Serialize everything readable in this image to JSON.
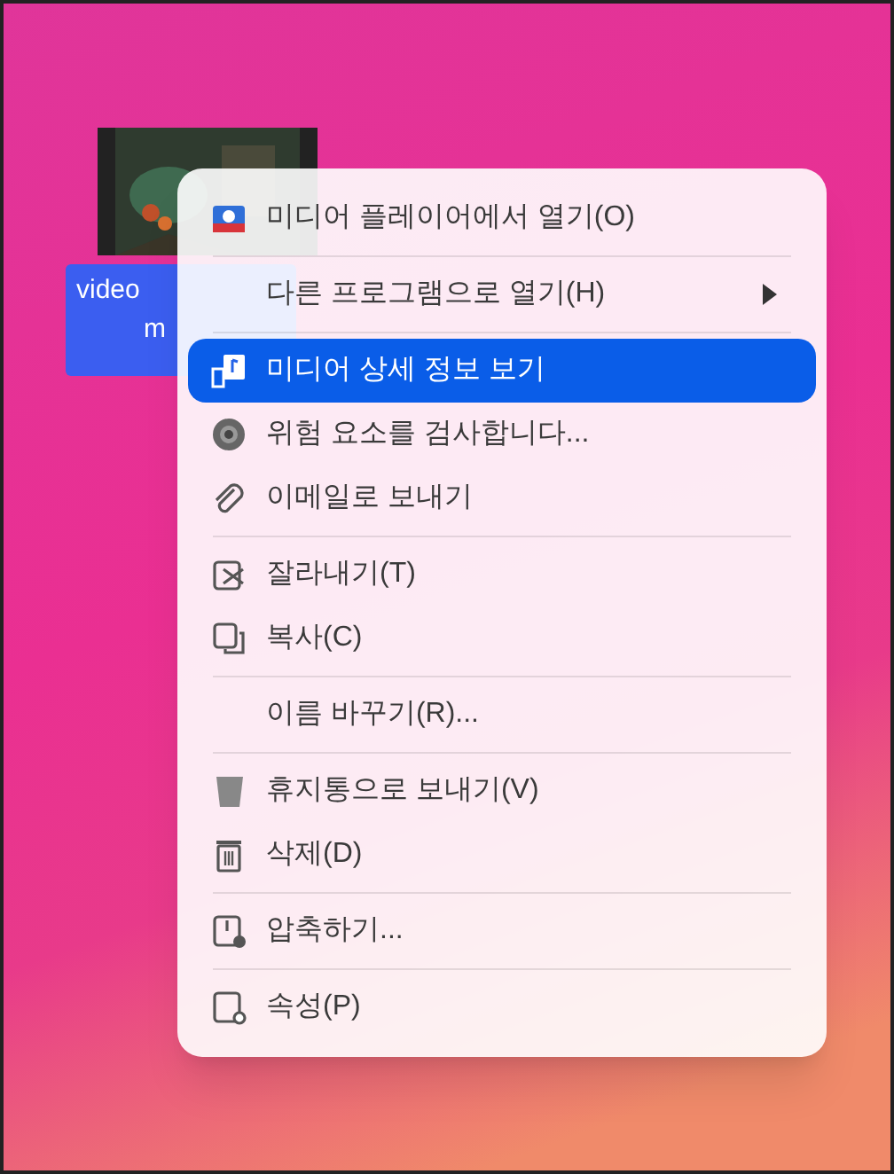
{
  "desktop_icon": {
    "label_lines": [
      "video",
      "m"
    ],
    "selected": true
  },
  "context_menu": {
    "items": [
      {
        "kind": "item",
        "label": "미디어 플레이어에서 열기(O)",
        "selected": false,
        "submenu": false
      },
      {
        "kind": "separator"
      },
      {
        "kind": "item",
        "label": "다른 프로그램으로 열기(H)",
        "selected": false,
        "submenu": true
      },
      {
        "kind": "separator"
      },
      {
        "kind": "item",
        "label": "미디어 상세 정보 보기",
        "selected": true,
        "submenu": false
      },
      {
        "kind": "item",
        "label": "위험 요소를 검사합니다...",
        "selected": false,
        "submenu": false
      },
      {
        "kind": "item",
        "label": "이메일로 보내기",
        "selected": false,
        "submenu": false
      },
      {
        "kind": "separator"
      },
      {
        "kind": "item",
        "label": "잘라내기(T)",
        "selected": false,
        "submenu": false
      },
      {
        "kind": "item",
        "label": "복사(C)",
        "selected": false,
        "submenu": false
      },
      {
        "kind": "separator"
      },
      {
        "kind": "item",
        "label": "이름 바꾸기(R)...",
        "selected": false,
        "submenu": false
      },
      {
        "kind": "separator"
      },
      {
        "kind": "item",
        "label": "휴지통으로 보내기(V)",
        "selected": false,
        "submenu": false
      },
      {
        "kind": "item",
        "label": "삭제(D)",
        "selected": false,
        "submenu": false
      },
      {
        "kind": "separator"
      },
      {
        "kind": "item",
        "label": "압축하기...",
        "selected": false,
        "submenu": false
      },
      {
        "kind": "separator"
      },
      {
        "kind": "item",
        "label": "속성(P)",
        "selected": false,
        "submenu": false
      }
    ]
  }
}
